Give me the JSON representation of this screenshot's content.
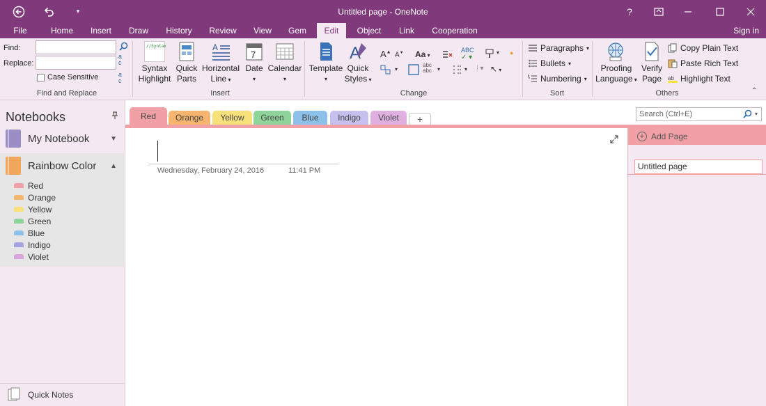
{
  "window": {
    "title": "Untitled page - OneNote",
    "help": "?",
    "back_icon": "back-arrow-icon",
    "undo_icon": "undo-icon"
  },
  "ribbon_tabs": [
    "File",
    "Home",
    "Insert",
    "Draw",
    "History",
    "Review",
    "View",
    "Gem",
    "Edit",
    "Object",
    "Link",
    "Cooperation"
  ],
  "active_tab": "Edit",
  "sign_in": "Sign in",
  "ribbon": {
    "find_replace": {
      "find_label": "Find:",
      "replace_label": "Replace:",
      "find_value": "",
      "replace_value": "",
      "case_sensitive": "Case Sensitive",
      "group": "Find and Replace"
    },
    "insert": {
      "syntax": "Syntax",
      "highlight": "Highlight",
      "quick": "Quick",
      "parts": "Parts",
      "horizontal": "Horizontal",
      "line": "Line",
      "date": "Date",
      "calendar": "Calendar",
      "group": "Insert",
      "syntax_preview": "//Syntax"
    },
    "change": {
      "template": "Template",
      "quick": "Quick",
      "styles": "Styles",
      "group": "Change",
      "aa": "Aa"
    },
    "sort": {
      "paragraphs": "Paragraphs",
      "bullets": "Bullets",
      "numbering": "Numbering",
      "group": "Sort"
    },
    "others": {
      "proofing": "Proofing",
      "language": "Language",
      "verify": "Verify",
      "page": "Page",
      "copy_plain": "Copy Plain Text",
      "paste_rich": "Paste Rich Text",
      "highlight_text": "Highlight Text",
      "group": "Others"
    }
  },
  "notebooks": {
    "header": "Notebooks",
    "items": [
      {
        "name": "My Notebook",
        "color": "#9b8ec4"
      },
      {
        "name": "Rainbow Color",
        "color": "#f0a65d"
      }
    ],
    "sections": [
      {
        "name": "Red",
        "color": "#f1a0a6"
      },
      {
        "name": "Orange",
        "color": "#f6b46e"
      },
      {
        "name": "Yellow",
        "color": "#f8e07a"
      },
      {
        "name": "Green",
        "color": "#8fd49a"
      },
      {
        "name": "Blue",
        "color": "#8ec1ea"
      },
      {
        "name": "Indigo",
        "color": "#a6a3e0"
      },
      {
        "name": "Violet",
        "color": "#d9a6dc"
      }
    ],
    "quick_notes": "Quick Notes"
  },
  "section_tabs": [
    {
      "name": "Red",
      "color": "#f1a0a6"
    },
    {
      "name": "Orange",
      "color": "#f6b46e"
    },
    {
      "name": "Yellow",
      "color": "#f8e07a"
    },
    {
      "name": "Green",
      "color": "#8fd49a"
    },
    {
      "name": "Blue",
      "color": "#8ec1ea"
    },
    {
      "name": "Indigo",
      "color": "#c5c0ee"
    },
    {
      "name": "Violet",
      "color": "#dfb0e0"
    }
  ],
  "add_section": "+",
  "page": {
    "date": "Wednesday, February 24, 2016",
    "time": "11:41 PM"
  },
  "search": {
    "placeholder": "Search (Ctrl+E)"
  },
  "pages_pane": {
    "add_page": "Add Page",
    "items": [
      "Untitled page"
    ]
  },
  "colors": {
    "brand": "#80397b",
    "ribbon_bg": "#f4e9f2",
    "active_section": "#f1a0a6"
  }
}
